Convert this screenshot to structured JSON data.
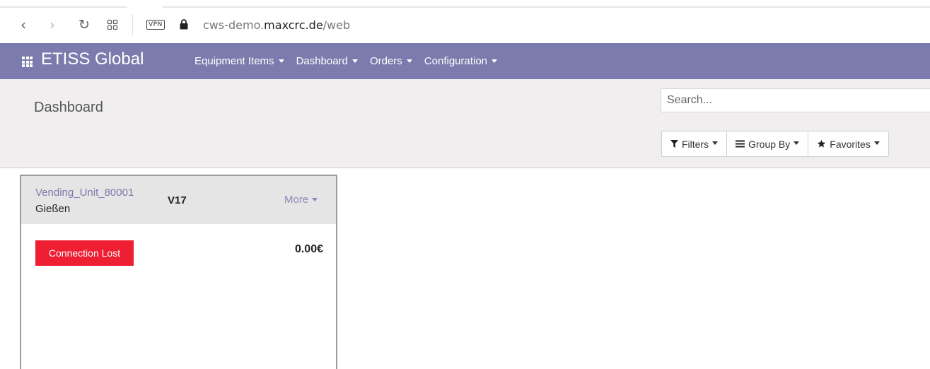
{
  "browser": {
    "vpn_label": "VPN",
    "url_prefix": "cws-demo.",
    "url_host": "maxcrc.de",
    "url_path": "/web"
  },
  "navbar": {
    "brand": "ETISS Global",
    "menu": [
      {
        "label": "Equipment Items"
      },
      {
        "label": "Dashboard"
      },
      {
        "label": "Orders"
      },
      {
        "label": "Configuration"
      }
    ],
    "background_color": "#7c7bad"
  },
  "control_panel": {
    "title": "Dashboard",
    "search_placeholder": "Search...",
    "filters_label": "Filters",
    "group_by_label": "Group By",
    "favorites_label": "Favorites"
  },
  "card": {
    "unit_name": "Vending_Unit_80001",
    "city": "Gießen",
    "version": "V17",
    "more_label": "More",
    "status": "Connection Lost",
    "status_color": "#ee1f33",
    "amount": "0.00€"
  }
}
